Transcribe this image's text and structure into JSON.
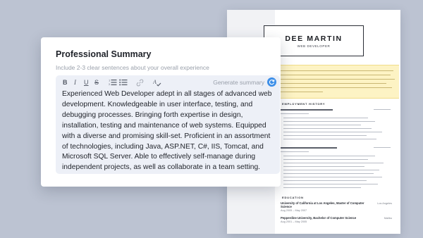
{
  "resume": {
    "name": "DEE MARTIN",
    "job_title": "WEB DEVELOPER",
    "sections": {
      "employment_history": "EMPLOYMENT HISTORY",
      "education": "EDUCATION"
    },
    "education": [
      {
        "degree": "University of California at Los Angeles, Master of Computer Science",
        "dates": "Aug 2005 – May 2007",
        "location": "Los Angeles"
      },
      {
        "degree": "Pepperdine University, Bachelor of Computer Science",
        "dates": "Aug 2001 – May 2005",
        "location": "Malibu"
      }
    ]
  },
  "editor": {
    "title": "Professional Summary",
    "hint": "Include 2-3 clear sentences about your overall experience",
    "toolbar": {
      "bold": "B",
      "italic": "I",
      "underline": "U",
      "strikethrough": "S",
      "generate_label": "Generate summary"
    },
    "content": "Experienced Web Developer adept in all stages of advanced web development. Knowledgeable in user interface, testing, and debugging processes. Bringing forth expertise in design, installation, testing and maintenance of web systems. Equipped with a diverse and promising skill-set. Proficient in an assortment of technologies, including Java, ASP.NET, C#, IIS, Tomcat, and Microsoft SQL Server. Able to effectively self-manage during independent projects, as well as collaborate in a team setting."
  },
  "icons": {
    "numbered_list": "numbered-list-icon",
    "bullet_list": "bullet-list-icon",
    "link": "link-icon",
    "spellcheck": "spellcheck-icon",
    "generate": "refresh-icon"
  },
  "colors": {
    "background": "#bcc3d2",
    "editor_bg": "#edf0f7",
    "accent": "#3d8fe8",
    "highlight": "#fdf3c4"
  }
}
